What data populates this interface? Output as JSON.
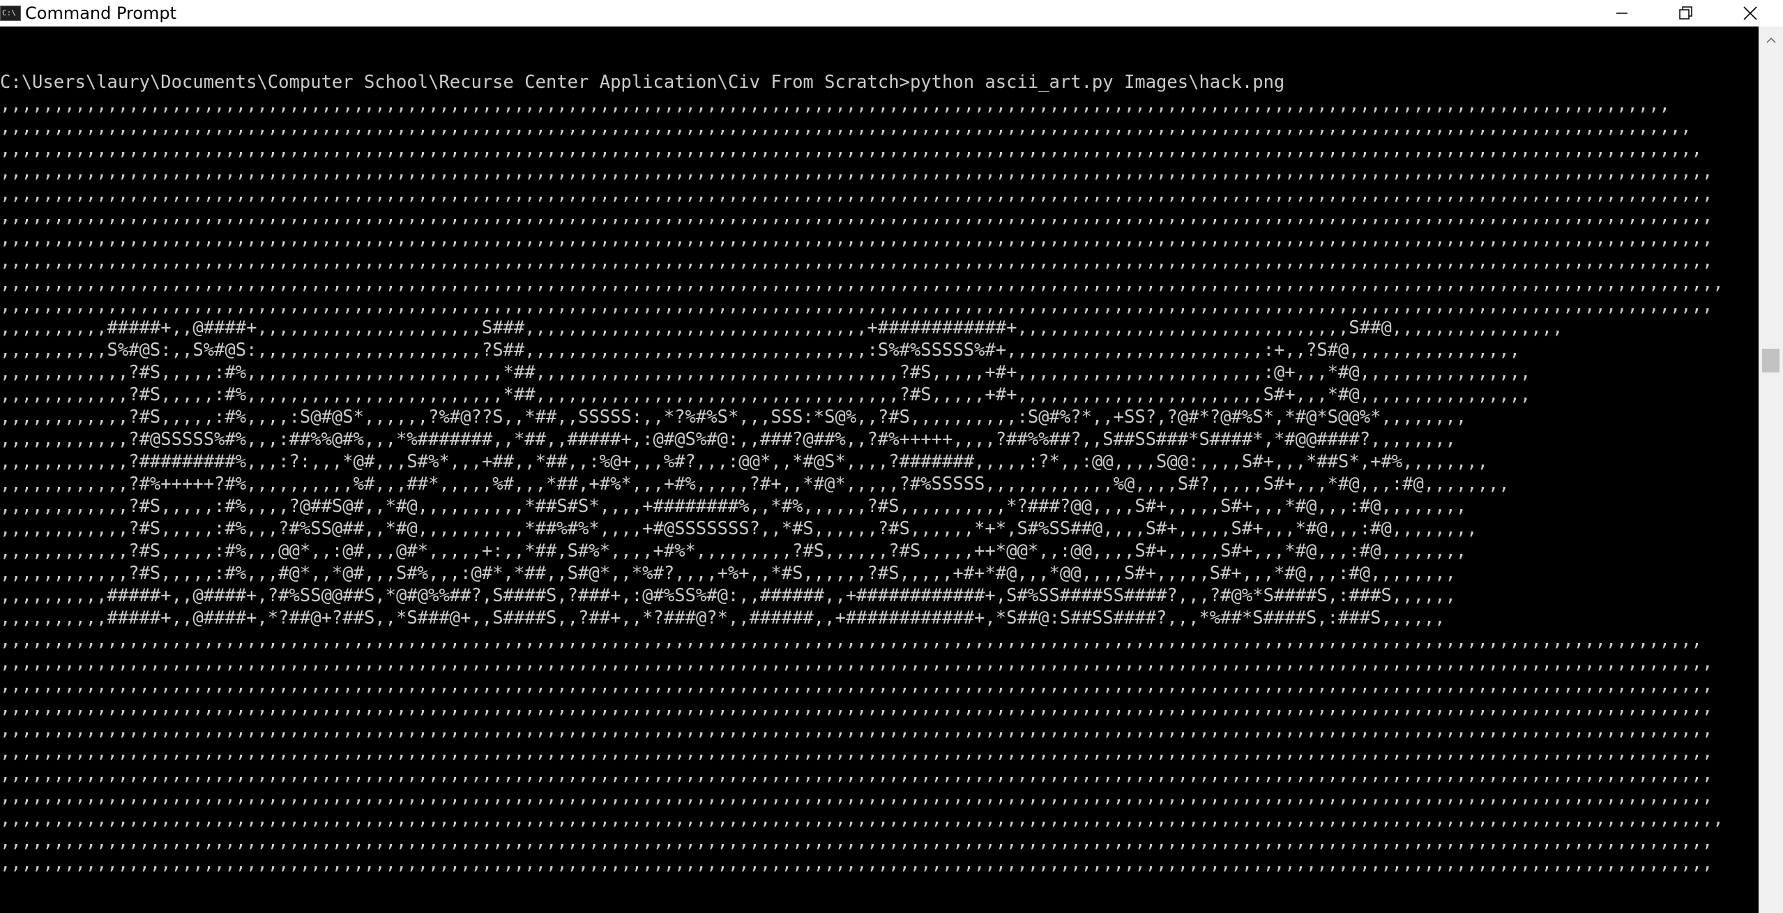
{
  "window": {
    "title": "Command Prompt",
    "app_icon_text": "C:\\",
    "icons": {
      "app": "command-prompt-icon",
      "minimize": "minimize-icon",
      "maximize": "restore-icon",
      "close": "close-icon",
      "scroll_up": "scroll-up-arrow-icon"
    }
  },
  "console": {
    "prompt": "C:\\Users\\laury\\Documents\\Computer School\\Recurse Center Application\\Civ From Scratch>python ascii_art.py Images\\hack.png",
    "output_lines": [
      ",,,,,,,,,,,,,,,,,,,,,,,,,,,,,,,,,,,,,,,,,,,,,,,,,,,,,,,,,,,,,,,,,,,,,,,,,,,,,,,,,,,,,,,,,,,,,,,,,,,,,,,,,,,,,,,,,,,,,,,,,,,,,,,,,,,,,,,,,,,,,,,,,,,,,,,,,,,,",
      ",,,,,,,,,,,,,,,,,,,,,,,,,,,,,,,,,,,,,,,,,,,,,,,,,,,,,,,,,,,,,,,,,,,,,,,,,,,,,,,,,,,,,,,,,,,,,,,,,,,,,,,,,,,,,,,,,,,,,,,,,,,,,,,,,,,,,,,,,,,,,,,,,,,,,,,,,,,,,,",
      ",,,,,,,,,,,,,,,,,,,,,,,,,,,,,,,,,,,,,,,,,,,,,,,,,,,,,,,,,,,,,,,,,,,,,,,,,,,,,,,,,,,,,,,,,,,,,,,,,,,,,,,,,,,,,,,,,,,,,,,,,,,,,,,,,,,,,,,,,,,,,,,,,,,,,,,,,,,,,,,",
      ",,,,,,,,,,,,,,,,,,,,,,,,,,,,,,,,,,,,,,,,,,,,,,,,,,,,,,,,,,,,,,,,,,,,,,,,,,,,,,,,,,,,,,,,,,,,,,,,,,,,,,,,,,,,,,,,,,,,,,,,,,,,,,,,,,,,,,,,,,,,,,,,,,,,,,,,,,,,,,,,",
      ",,,,,,,,,,,,,,,,,,,,,,,,,,,,,,,,,,,,,,,,,,,,,,,,,,,,,,,,,,,,,,,,,,,,,,,,,,,,,,,,,,,,,,,,,,,,,,,,,,,,,,,,,,,,,,,,,,,,,,,,,,,,,,,,,,,,,,,,,,,,,,,,,,,,,,,,,,,,,,,,",
      ",,,,,,,,,,,,,,,,,,,,,,,,,,,,,,,,,,,,,,,,,,,,,,,,,,,,,,,,,,,,,,,,,,,,,,,,,,,,,,,,,,,,,,,,,,,,,,,,,,,,,,,,,,,,,,,,,,,,,,,,,,,,,,,,,,,,,,,,,,,,,,,,,,,,,,,,,,,,,,,,",
      ",,,,,,,,,,,,,,,,,,,,,,,,,,,,,,,,,,,,,,,,,,,,,,,,,,,,,,,,,,,,,,,,,,,,,,,,,,,,,,,,,,,,,,,,,,,,,,,,,,,,,,,,,,,,,,,,,,,,,,,,,,,,,,,,,,,,,,,,,,,,,,,,,,,,,,,,,,,,,,,,",
      ",,,,,,,,,,,,,,,,,,,,,,,,,,,,,,,,,,,,,,,,,,,,,,,,,,,,,,,,,,,,,,,,,,,,,,,,,,,,,,,,,,,,,,,,,,,,,,,,,,,,,,,,,,,,,,,,,,,,,,,,,,,,,,,,,,,,,,,,,,,,,,,,,,,,,,,,,,,,,,,,",
      ",,,,,,,,,,,,,,,,,,,,,,,,,,,,,,,,,,,,,,,,,,,,,,,,,,,,,,,,,,,,,,,,,,,,,,,,,,,,,,,,,,,,,,,,,,,,,,,,,,,,,,,,,,,,,,,,,,,,,,,,,,,,,,,,,,,,,,,,,,,,,,,,,,,,,,,,,,,,,,,,,",
      ",,,,,,,,,,,,,,,,,,,,,,,,,,,,,,,,,,,,,,,,,,,,,,,,,,,,,,,,,,,,,,,,,,,,,,,,,,,,,,,,,,,,,,,,,,,,,,,,,,,,,,,,,,,,,,,,,,,,,,,,,,,,,,,,,,,,,,,,,,,,,,,,,,,,,,,,,,,,,,,,",
      ",,,,,,,,,,#####+,,@####+,,,,,,,,,,,,,,,,,,,,,S###,,,,,,,,,,,,,,,,,,,,,,,,,,,,,,,,+############+,,,,,,,,,,,,,,,,,,,,,,,,,,,,,,,S##@,,,,,,,,,,,,,,,,",
      ",,,,,,,,,,S%#@S:,,S%#@S:,,,,,,,,,,,,,,,,,,,,,?S##,,,,,,,,,,,,,,,,,,,,,,,,,,,,,,,,:S%#%SSSSS%#+,,,,,,,,,,,,,,,,,,,,,,,,:+,,?S#@,,,,,,,,,,,,,,,,",
      ",,,,,,,,,,,,?#S,,,,,:#%,,,,,,,,,,,,,,,,,,,,,,,,*##,,,,,,,,,,,,,,,,,,,,,,,,,,,,,,,,,,?#S,,,,,+#+,,,,,,,,,,,,,,,,,,,,,,,:@+,,,*#@,,,,,,,,,,,,,,,,",
      ",,,,,,,,,,,,?#S,,,,,:#%,,,,,,,,,,,,,,,,,,,,,,,,*##,,,,,,,,,,,,,,,,,,,,,,,,,,,,,,,,,,?#S,,,,,+#+,,,,,,,,,,,,,,,,,,,,,,,S#+,,,*#@,,,,,,,,,,,,,,,,",
      ",,,,,,,,,,,,?#S,,,,,:#%,,,,:S@#@S*,,,,,,?%#@??S,,*##,,SSSSS:,,*?%#%S*,,,SSS:*S@%,,?#S,,,,,,,,,,:S@#%?*,,+SS?,?@#*?@#%S*,*#@*S@@%*,,,,,,,,",
      ",,,,,,,,,,,,?#@SSSSS%#%,,,:##%%@#%,,,*%#######,,*##,,#####+,:@#@S%#@:,,###?@##%,,?#%+++++,,,,?##%%##?,,S##SS###*S####*,*#@@####?,,,,,,,,",
      ",,,,,,,,,,,,?#########%,,,:?:,,,*@#,,,S#%*,,,+##,,*##,,:%@+,,,%#?,,,:@@*,,*#@S*,,,,?#######,,,,,:?*,,:@@,,,,S@@:,,,,S#+,,,*##S*,+#%,,,,,,,,",
      ",,,,,,,,,,,,?#%+++++?#%,,,,,,,,,,%#,,,##*,,,,,%#,,,*##,+#%*,,,+#%,,,,,?#+,,*#@*,,,,,?#%SSSSS,,,,,,,,,,,,%@,,,,S#?,,,,,S#+,,,*#@,,,:#@,,,,,,,,",
      ",,,,,,,,,,,,?#S,,,,,:#%,,,,?@##S@#,,*#@,,,,,,,,,,*##S#S*,,,,+########%,,*#%,,,,,,?#S,,,,,,,,,,*?###?@@,,,,S#+,,,,,S#+,,,*#@,,,:#@,,,,,,,,",
      ",,,,,,,,,,,,?#S,,,,,:#%,,,?#%SS@##,,*#@,,,,,,,,,,*##%#%*,,,,+#@SSSSSSS?,,*#S,,,,,,?#S,,,,,,*+*,S#%SS##@,,,,S#+,,,,,S#+,,,*#@,,,:#@,,,,,,,,",
      ",,,,,,,,,,,,?#S,,,,,:#%,,,@@*,,:@#,,,@#*,,,,,+:,,*##,S#%*,,,,+#%*,,,,,,,,,?#S,,,,,,?#S,,,,,++*@@*,,:@@,,,,S#+,,,,,S#+,,,*#@,,,:#@,,,,,,,,",
      ",,,,,,,,,,,,?#S,,,,,:#%,,,#@*,,*@#,,,S#%,,,:@#*,*##,,S#@*,,*%#?,,,,+%+,,*#S,,,,,,?#S,,,,,+#+*#@,,,*@@,,,,S#+,,,,,S#+,,,*#@,,,:#@,,,,,,,,",
      ",,,,,,,,,,#####+,,@####+,?#%SS@@##S,*@#@%%##?,S####S,?###+,:@#%SS%#@:,,######,,+############+,S#%SS####SS####?,,,?#@%*S####S,:###S,,,,,,",
      ",,,,,,,,,,#####+,,@####+,*?##@+?##S,,*S###@+,,S####S,,?##+,,*?###@?*,,######,,+############+,*S##@:S##SS####?,,,*%##*S####S,:###S,,,,,,",
      ",,,,,,,,,,,,,,,,,,,,,,,,,,,,,,,,,,,,,,,,,,,,,,,,,,,,,,,,,,,,,,,,,,,,,,,,,,,,,,,,,,,,,,,,,,,,,,,,,,,,,,,,,,,,,,,,,,,,,,,,,,,,,,,,,,,,,,,,,,,,,,,,,,,,,,,,,,,,,,,",
      ",,,,,,,,,,,,,,,,,,,,,,,,,,,,,,,,,,,,,,,,,,,,,,,,,,,,,,,,,,,,,,,,,,,,,,,,,,,,,,,,,,,,,,,,,,,,,,,,,,,,,,,,,,,,,,,,,,,,,,,,,,,,,,,,,,,,,,,,,,,,,,,,,,,,,,,,,,,,,,,,",
      ",,,,,,,,,,,,,,,,,,,,,,,,,,,,,,,,,,,,,,,,,,,,,,,,,,,,,,,,,,,,,,,,,,,,,,,,,,,,,,,,,,,,,,,,,,,,,,,,,,,,,,,,,,,,,,,,,,,,,,,,,,,,,,,,,,,,,,,,,,,,,,,,,,,,,,,,,,,,,,,,",
      ",,,,,,,,,,,,,,,,,,,,,,,,,,,,,,,,,,,,,,,,,,,,,,,,,,,,,,,,,,,,,,,,,,,,,,,,,,,,,,,,,,,,,,,,,,,,,,,,,,,,,,,,,,,,,,,,,,,,,,,,,,,,,,,,,,,,,,,,,,,,,,,,,,,,,,,,,,,,,,,,",
      ",,,,,,,,,,,,,,,,,,,,,,,,,,,,,,,,,,,,,,,,,,,,,,,,,,,,,,,,,,,,,,,,,,,,,,,,,,,,,,,,,,,,,,,,,,,,,,,,,,,,,,,,,,,,,,,,,,,,,,,,,,,,,,,,,,,,,,,,,,,,,,,,,,,,,,,,,,,,,,,,",
      ",,,,,,,,,,,,,,,,,,,,,,,,,,,,,,,,,,,,,,,,,,,,,,,,,,,,,,,,,,,,,,,,,,,,,,,,,,,,,,,,,,,,,,,,,,,,,,,,,,,,,,,,,,,,,,,,,,,,,,,,,,,,,,,,,,,,,,,,,,,,,,,,,,,,,,,,,,,,,,,,",
      ",,,,,,,,,,,,,,,,,,,,,,,,,,,,,,,,,,,,,,,,,,,,,,,,,,,,,,,,,,,,,,,,,,,,,,,,,,,,,,,,,,,,,,,,,,,,,,,,,,,,,,,,,,,,,,,,,,,,,,,,,,,,,,,,,,,,,,,,,,,,,,,,,,,,,,,,,,,,,,,,",
      ",,,,,,,,,,,,,,,,,,,,,,,,,,,,,,,,,,,,,,,,,,,,,,,,,,,,,,,,,,,,,,,,,,,,,,,,,,,,,,,,,,,,,,,,,,,,,,,,,,,,,,,,,,,,,,,,,,,,,,,,,,,,,,,,,,,,,,,,,,,,,,,,,,,,,,,,,,,,,,,,",
      ",,,,,,,,,,,,,,,,,,,,,,,,,,,,,,,,,,,,,,,,,,,,,,,,,,,,,,,,,,,,,,,,,,,,,,,,,,,,,,,,,,,,,,,,,,,,,,,,,,,,,,,,,,,,,,,,,,,,,,,,,,,,,,,,,,,,,,,,,,,,,,,,,,,,,,,,,,,,,,,,,",
      ",,,,,,,,,,,,,,,,,,,,,,,,,,,,,,,,,,,,,,,,,,,,,,,,,,,,,,,,,,,,,,,,,,,,,,,,,,,,,,,,,,,,,,,,,,,,,,,,,,,,,,,,,,,,,,,,,,,,,,,,,,,,,,,,,,,,,,,,,,,,,,,,,,,,,,,,,,,,,,,,",
      ",,,,,,,,,,,,,,,,,,,,,,,,,,,,,,,,,,,,,,,,,,,,,,,,,,,,,,,,,,,,,,,,,,,,,,,,,,,,,,,,,,,,,,,,,,,,,,,,,,,,,,,,,,,,,,,,,,,,,,,,,,,,,,,,,,,,,,,,,,,,,,,,,,,,,,,,,,,,,,,,"
    ]
  },
  "colors": {
    "console_background": "#000000",
    "console_text": "#cccccc",
    "titlebar_background": "#ffffff"
  }
}
